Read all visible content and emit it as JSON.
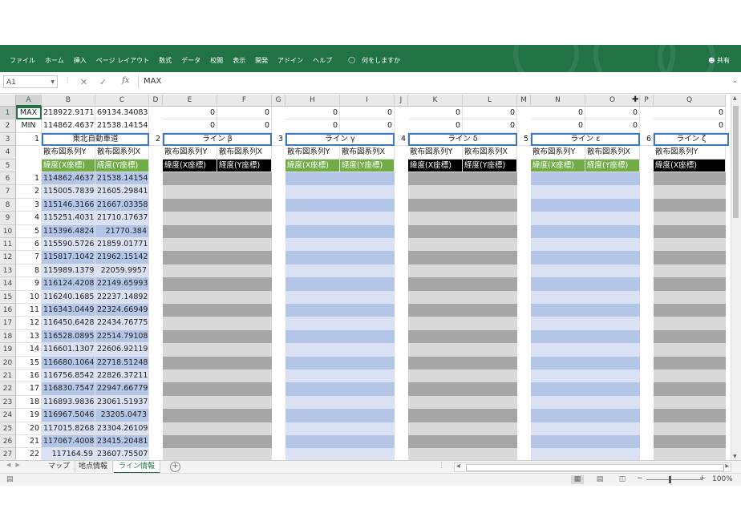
{
  "ribbon": {
    "tabs": [
      "ファイル",
      "ホーム",
      "挿入",
      "ページ レイアウト",
      "数式",
      "データ",
      "校閲",
      "表示",
      "開発",
      "アドイン",
      "ヘルプ"
    ],
    "tell_me": "何をしますか",
    "share": "共有"
  },
  "formula_bar": {
    "name_box": "A1",
    "fx": "fx",
    "content": "MAX"
  },
  "columns": [
    "A",
    "B",
    "C",
    "D",
    "E",
    "F",
    "G",
    "H",
    "I",
    "J",
    "K",
    "L",
    "M",
    "N",
    "O",
    "P",
    "Q"
  ],
  "row_numbers": [
    "1",
    "2",
    "3",
    "4",
    "5",
    "6",
    "7",
    "8",
    "9",
    "10",
    "11",
    "12",
    "13",
    "14",
    "15",
    "16",
    "17",
    "18",
    "19",
    "20",
    "21",
    "22",
    "23",
    "24",
    "25",
    "26",
    "27"
  ],
  "sheet": {
    "row1": {
      "a": "MAX",
      "b": "218922.9171",
      "c": "69134.34083",
      "e": "0",
      "f": "0",
      "h": "0",
      "i": "0",
      "k": "0",
      "l": "0",
      "n": "0",
      "o": "0",
      "q": "0"
    },
    "row2": {
      "a": "MIN",
      "b": "114862.4637",
      "c": "21538.14154",
      "e": "0",
      "f": "0",
      "h": "0",
      "i": "0",
      "k": "0",
      "l": "0",
      "n": "0",
      "o": "0",
      "q": "0"
    },
    "line_numbers": [
      "1",
      "2",
      "3",
      "4",
      "5",
      "6"
    ],
    "line_titles": [
      "東北自動車道",
      "ライン β",
      "ライン γ",
      "ライン δ",
      "ライン ε",
      "ライン ζ"
    ],
    "series_y": "散布図系列Y",
    "series_x": "散布図系列X",
    "lat_label": "緯度(X座標)",
    "lon_label": "経度(Y座標)",
    "data": [
      [
        "1",
        "114862.4637",
        "21538.14154"
      ],
      [
        "2",
        "115005.7839",
        "21605.29841"
      ],
      [
        "3",
        "115146.3166",
        "21667.03358"
      ],
      [
        "4",
        "115251.4031",
        "21710.17637"
      ],
      [
        "5",
        "115396.4824",
        "21770.384"
      ],
      [
        "6",
        "115590.5726",
        "21859.01771"
      ],
      [
        "7",
        "115817.1042",
        "21962.15142"
      ],
      [
        "8",
        "115989.1379",
        "22059.9957"
      ],
      [
        "9",
        "116124.4208",
        "22149.65993"
      ],
      [
        "10",
        "116240.1685",
        "22237.14892"
      ],
      [
        "11",
        "116343.0449",
        "22324.66949"
      ],
      [
        "12",
        "116450.6428",
        "22434.76775"
      ],
      [
        "13",
        "116528.0895",
        "22514.79108"
      ],
      [
        "14",
        "116601.1307",
        "22606.92119"
      ],
      [
        "15",
        "116680.1064",
        "22718.51248"
      ],
      [
        "16",
        "116756.8542",
        "22826.37211"
      ],
      [
        "17",
        "116830.7547",
        "22947.66779"
      ],
      [
        "18",
        "116893.9836",
        "23061.51937"
      ],
      [
        "19",
        "116967.5046",
        "23205.0473"
      ],
      [
        "20",
        "117015.8268",
        "23304.26109"
      ],
      [
        "21",
        "117067.4008",
        "23415.20481"
      ],
      [
        "22",
        "117164.59",
        "23607.75507"
      ]
    ]
  },
  "sheet_tabs": [
    "マップ",
    "地点情報",
    "ライン情報"
  ],
  "active_sheet_index": 2,
  "status": {
    "zoom": "100%",
    "minus": "−",
    "plus": "+"
  },
  "colors": {
    "excel_green": "#217346",
    "label_green": "#70ad47",
    "blue_dark": "#b4c6e7",
    "blue_light": "#d9e1f2",
    "gray_dark": "#a6a6a6",
    "gray_light": "#d9d9d9"
  }
}
